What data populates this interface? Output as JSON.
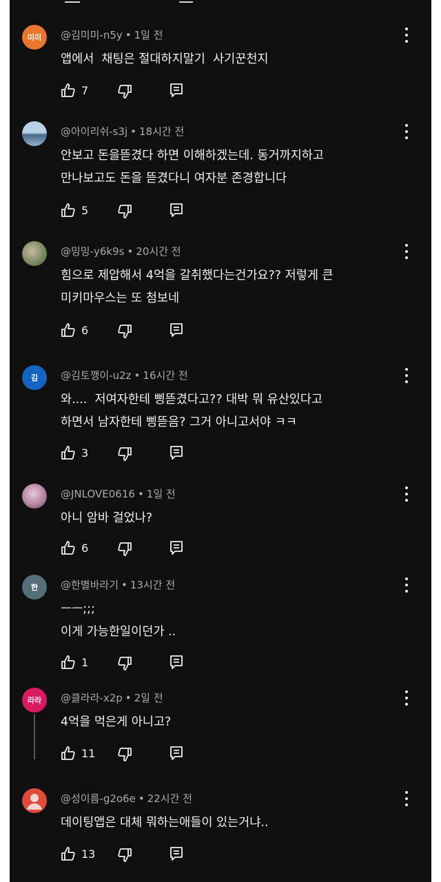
{
  "comments": [
    {
      "avatar_text": "미미",
      "avatar_color": "#e8762c",
      "author": "@김미미-n5y",
      "time": "1일 전",
      "text": "앱에서  채팅은 절대하지말기  사기꾼천지",
      "likes": "7"
    },
    {
      "avatar_text": "",
      "avatar_color": "#7fa9c6",
      "author": "@아이리쉬-s3j",
      "time": "18시간 전",
      "text": "안보고 돈을뜯겼다 하면 이해하겠는데. 동거까지하고\n만나보고도 돈을 뜯겼다니 여자분 존경합니다",
      "likes": "5"
    },
    {
      "avatar_text": "",
      "avatar_color": "#7c8a63",
      "author": "@밍밍-y6k9s",
      "time": "20시간 전",
      "text": "힘으로 제압해서 4억을 갈취했다는건가요?? 저렇게 큰\n미키마우스는 또 첨보네",
      "likes": "6"
    },
    {
      "avatar_text": "김",
      "avatar_color": "#1565c0",
      "author": "@김토깽이-u2z",
      "time": "16시간 전",
      "text": "와....  저여자한테 삥뜯겼다고?? 대박 뭐 유산있다고\n하면서 남자한테 삥뜯음? 그거 아니고서야 ㅋㅋ",
      "likes": "3"
    },
    {
      "avatar_text": "",
      "avatar_color": "#b98aa6",
      "author": "@JNLOVE0616",
      "time": "1일 전",
      "text": "아니 암바 걸었나?",
      "likes": "6"
    },
    {
      "avatar_text": "한",
      "avatar_color": "#546e7a",
      "author": "@한별바라기",
      "time": "13시간 전",
      "text": "ㅡㅡ;;;\n이게 가능한일이던가 ..",
      "likes": "1"
    },
    {
      "avatar_text": "라라",
      "avatar_color": "#d81b60",
      "author": "@클라라-x2p",
      "time": "2일 전",
      "text": "4억을 먹은게 아니고?",
      "likes": "11"
    },
    {
      "avatar_text": "",
      "avatar_color": "#e04a3a",
      "author": "@성이름-g2o6e",
      "time": "22시간 전",
      "text": "데이팅앱은 대체 뭐하는애들이 있는거냐..",
      "likes": "13"
    }
  ]
}
